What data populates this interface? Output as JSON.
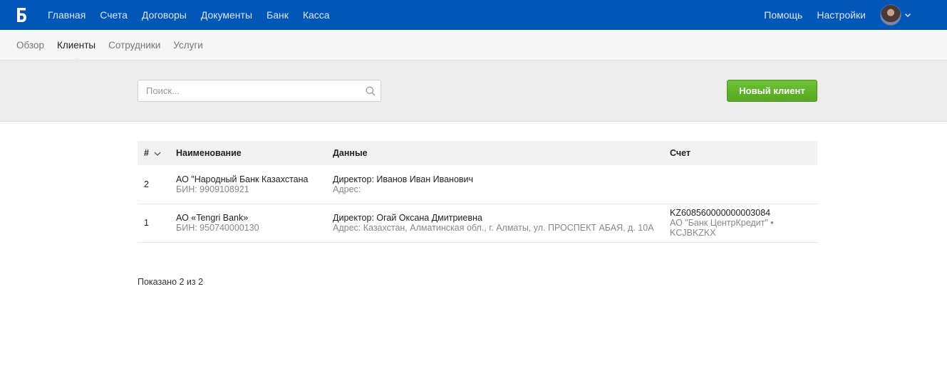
{
  "app": {
    "logo_letter": "Б"
  },
  "topnav": {
    "items": [
      "Главная",
      "Счета",
      "Договоры",
      "Документы",
      "Банк",
      "Касса"
    ],
    "right": [
      "Помощь",
      "Настройки"
    ]
  },
  "subnav": {
    "items": [
      "Обзор",
      "Клиенты",
      "Сотрудники",
      "Услуги"
    ],
    "active": "Клиенты"
  },
  "toolbar": {
    "search_placeholder": "Поиск...",
    "new_button": "Новый клиент"
  },
  "table": {
    "headers": [
      "#",
      "Наименование",
      "Данные",
      "Счет"
    ],
    "rows": [
      {
        "num": "2",
        "name": "АО \"Народный Банк Казахстана",
        "bin": "БИН: 9909108921",
        "director": "Директор: Иванов Иван Иванович",
        "address": "Адрес:",
        "account": "",
        "bank": ""
      },
      {
        "num": "1",
        "name": "АО «Tengri Bank»",
        "bin": "БИН: 950740000130",
        "director": "Директор: Огай Оксана Дмитриевна",
        "address": "Адрес: Казахстан, Алматинская обл., г. Алматы, ул. ПРОСПЕКТ АБАЯ, д. 10А",
        "account": "KZ608560000000003084",
        "bank": "АО \"Банк ЦентрКредит\" • KCJBKZKX"
      }
    ]
  },
  "footer": {
    "count_text": "Показано 2 из 2"
  },
  "colors": {
    "topbar": "#0057b8",
    "button_green": "#5cb026"
  }
}
